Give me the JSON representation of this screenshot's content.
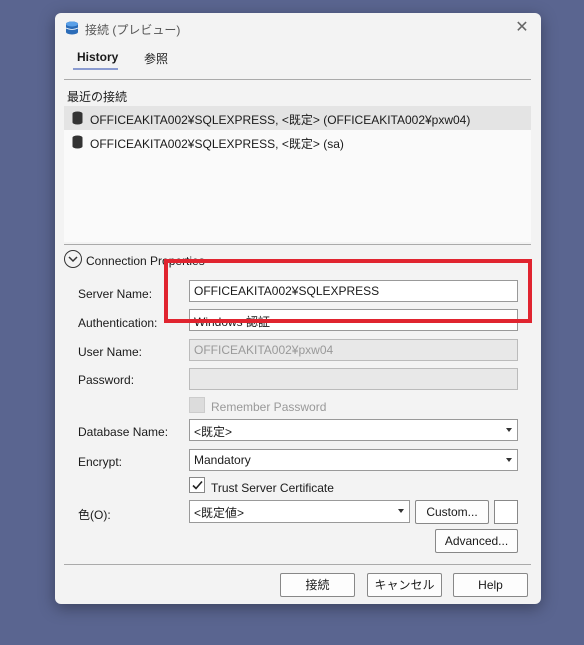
{
  "window": {
    "title": "接続 (プレビュー)"
  },
  "tabs": [
    {
      "label": "History"
    },
    {
      "label": "参照"
    }
  ],
  "history": {
    "section_label": "最近の接続",
    "items": [
      {
        "label": "OFFICEAKITA002¥SQLEXPRESS, <既定> (OFFICEAKITA002¥pxw04)",
        "selected": true
      },
      {
        "label": "OFFICEAKITA002¥SQLEXPRESS, <既定> (sa)",
        "selected": false
      }
    ]
  },
  "connection_properties": {
    "title": "Connection Properties",
    "server_name": {
      "label": "Server Name:",
      "value": "OFFICEAKITA002¥SQLEXPRESS"
    },
    "authentication": {
      "label": "Authentication:",
      "value": "Windows 認証"
    },
    "user_name": {
      "label": "User Name:",
      "value": "OFFICEAKITA002¥pxw04"
    },
    "password": {
      "label": "Password:",
      "value": ""
    },
    "remember_password": {
      "label": "Remember Password",
      "checked": false
    },
    "database_name": {
      "label": "Database Name:",
      "value": "<既定>"
    },
    "encrypt": {
      "label": "Encrypt:",
      "value": "Mandatory"
    },
    "trust_server_certificate": {
      "label": "Trust Server Certificate",
      "checked": true
    },
    "color": {
      "label": "色(O):",
      "value": "<既定値>",
      "custom_button": "Custom..."
    },
    "advanced_button": "Advanced..."
  },
  "footer": {
    "connect": "接続",
    "cancel": "キャンセル",
    "help": "Help"
  },
  "colors": {
    "highlight": "#e0242f",
    "tab_underline": "#8a9bd0",
    "background": "#5a6590"
  },
  "icons": {
    "app": "database-icon",
    "close": "close-icon",
    "history_item": "database-icon",
    "expander": "chevron-down-icon"
  }
}
